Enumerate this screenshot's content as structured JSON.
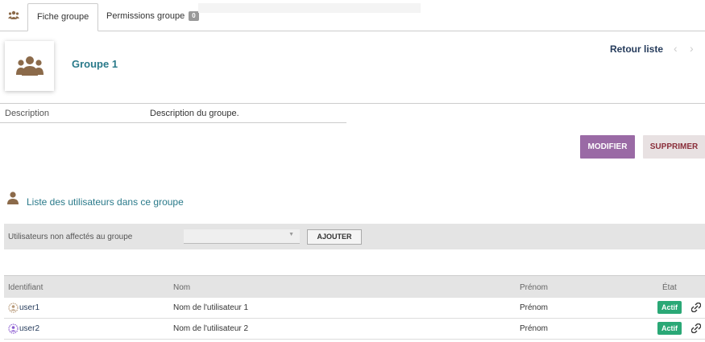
{
  "tabs": {
    "icon": "users-icon",
    "active_label": "Fiche groupe",
    "second_label": "Permissions groupe",
    "second_count": "0"
  },
  "group": {
    "name": "Groupe 1",
    "icon": "group-users-icon"
  },
  "nav": {
    "back_label": "Retour liste",
    "prev": "‹",
    "next": "›"
  },
  "description": {
    "label": "Description",
    "value": "Description du groupe."
  },
  "actions": {
    "modify": "MODIFIER",
    "delete": "SUPPRIMER"
  },
  "users_section": {
    "title": "Liste des utilisateurs dans ce groupe",
    "icon": "user-icon"
  },
  "assign": {
    "label": "Utilisateurs non affectés au groupe",
    "select_value": "",
    "add_button": "AJOUTER"
  },
  "table": {
    "headers": [
      "Identifiant",
      "Nom",
      "Prénom",
      "État"
    ],
    "rows": [
      {
        "login": "user1",
        "name": "Nom de l'utilisateur 1",
        "firstname": "Prénom",
        "status": "Actif"
      },
      {
        "login": "user2",
        "name": "Nom de l'utilisateur 2",
        "firstname": "Prénom",
        "status": "Actif"
      }
    ]
  },
  "colors": {
    "accent_teal": "#2a7a8a",
    "modify_purple": "#9a6aa5",
    "delete_red": "#8a2e3a",
    "status_green": "#2aa876",
    "link_navy": "#263c5c"
  }
}
